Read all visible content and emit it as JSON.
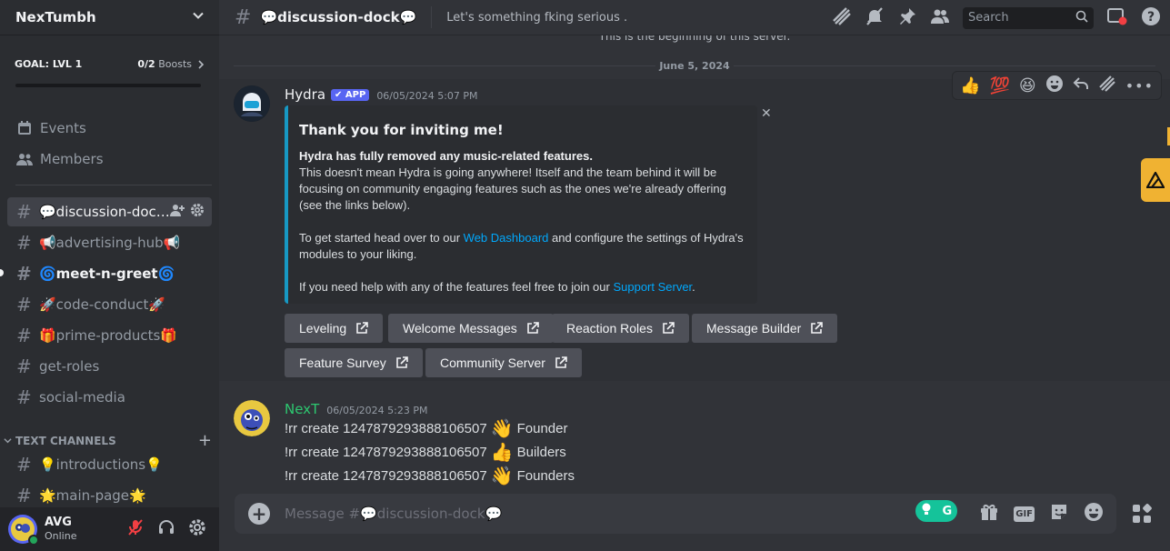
{
  "server": {
    "name": "NexTumbh"
  },
  "goal": {
    "label": "GOAL: LVL 1",
    "count": "0/2",
    "boosts_word": "Boosts",
    "progress": 0
  },
  "nav": {
    "events": "Events",
    "members": "Members"
  },
  "channels": [
    {
      "label": "💬discussion-doc…",
      "state": "active"
    },
    {
      "label": "📢advertising-hub📢",
      "state": "normal"
    },
    {
      "label": "🌀meet-n-greet🌀",
      "state": "unread"
    },
    {
      "label": "🚀code-conduct🚀",
      "state": "normal"
    },
    {
      "label": "🎁prime-products🎁",
      "state": "normal"
    },
    {
      "label": "get-roles",
      "state": "normal"
    },
    {
      "label": "social-media",
      "state": "normal"
    }
  ],
  "category": {
    "label": "TEXT CHANNELS"
  },
  "text_channels": [
    {
      "label": "💡introductions💡"
    },
    {
      "label": "🌟main-page🌟"
    }
  ],
  "user": {
    "name": "AVG",
    "status": "Online"
  },
  "topbar": {
    "channel_title": "💬discussion-dock💬",
    "topic": "Let's something fking serious .",
    "search_placeholder": "Search"
  },
  "chat": {
    "beginning_text": "This is the beginning of this server.",
    "date_divider": "June 5, 2024",
    "hover_reactions": [
      "👍",
      "💯",
      "😆"
    ],
    "messages": [
      {
        "author": "Hydra",
        "badge": "✔ APP",
        "timestamp": "06/05/2024 5:07 PM",
        "embed": {
          "title": "Thank you for inviting me!",
          "bold_line": "Hydra has fully removed any music-related features.",
          "p1": "This doesn't mean Hydra is going anywhere! Itself and the team behind it will be focusing on community engaging features such as the ones we're already offering (see the links below).",
          "p2_before": "To get started head over to our ",
          "p2_link": "Web Dashboard",
          "p2_after": " and configure the settings of Hydra's modules to your liking.",
          "p3_before": "If you need help with any of the features feel free to join our ",
          "p3_link": "Support Server",
          "p3_after": "."
        },
        "buttons": [
          "Leveling",
          "Welcome Messages",
          "Reaction Roles",
          "Message Builder",
          "Feature Survey",
          "Community Server"
        ]
      },
      {
        "author": "NexT",
        "author_color": "#2dc770",
        "timestamp": "06/05/2024 5:23 PM",
        "lines": [
          {
            "cmd": "!rr create 1247879293888106507",
            "emoji": "👋",
            "role": "Founder"
          },
          {
            "cmd": "!rr create 1247879293888106507",
            "emoji": "👍",
            "role": "Builders"
          },
          {
            "cmd": "!rr create 1247879293888106507",
            "emoji": "👋",
            "role": "Founders"
          }
        ]
      }
    ]
  },
  "composer": {
    "placeholder": "Message #💬discussion-dock💬",
    "gif_label": "GIF",
    "grammarly_label": "G"
  },
  "colors": {
    "accent": "#5865f2",
    "link": "#00a8fc",
    "embed_border": "#1798c3",
    "online": "#23a55a",
    "muted_red": "#f23f43"
  }
}
